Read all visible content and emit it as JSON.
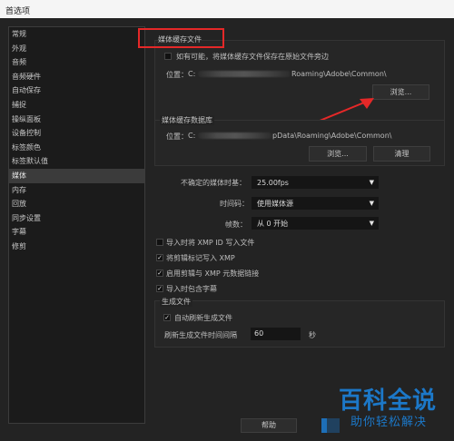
{
  "window": {
    "title": "首选项"
  },
  "sidebar": {
    "items": [
      {
        "label": "常规"
      },
      {
        "label": "外观"
      },
      {
        "label": "音频"
      },
      {
        "label": "音频硬件"
      },
      {
        "label": "自动保存"
      },
      {
        "label": "捕捉"
      },
      {
        "label": "操纵面板"
      },
      {
        "label": "设备控制"
      },
      {
        "label": "标签颜色"
      },
      {
        "label": "标签默认值"
      },
      {
        "label": "媒体"
      },
      {
        "label": "内存"
      },
      {
        "label": "回放"
      },
      {
        "label": "同步设置"
      },
      {
        "label": "字幕"
      },
      {
        "label": "修剪"
      }
    ],
    "selected": "媒体"
  },
  "media_cache_files": {
    "title": "媒体缓存文件",
    "checkbox_label": "如有可能，将媒体缓存文件保存在原始文件旁边",
    "location_label": "位置：",
    "location_prefix": "C:",
    "location_suffix": "Roaming\\Adobe\\Common\\",
    "browse_label": "浏览..."
  },
  "media_cache_db": {
    "title": "媒体缓存数据库",
    "location_label": "位置：",
    "location_prefix": "C:",
    "location_suffix": "pData\\Roaming\\Adobe\\Common\\",
    "browse_label": "浏览...",
    "clean_label": "清理"
  },
  "settings": {
    "timebase_label": "不确定的媒体时基：",
    "timebase_value": "25.00fps",
    "timecode_label": "时间码：",
    "timecode_value": "使用媒体源",
    "frame_label": "帧数：",
    "frame_value": "从 0 开始"
  },
  "options": [
    {
      "label": "导入时将 XMP ID 写入文件",
      "checked": false
    },
    {
      "label": "将剪辑标记写入 XMP",
      "checked": true
    },
    {
      "label": "启用剪辑与 XMP 元数据链接",
      "checked": true
    },
    {
      "label": "导入时包含字幕",
      "checked": true
    }
  ],
  "generate": {
    "title": "生成文件",
    "auto_refresh_label": "自动刷新生成文件",
    "interval_label": "刷新生成文件时间间隔",
    "interval_value": "60",
    "interval_unit": "秒"
  },
  "footer": {
    "help_label": "帮助"
  },
  "watermark": {
    "big": "百科全说",
    "small": "助你轻松解决"
  },
  "colors": {
    "accent_red": "#e52828",
    "brand_blue": "#1c78c8"
  }
}
